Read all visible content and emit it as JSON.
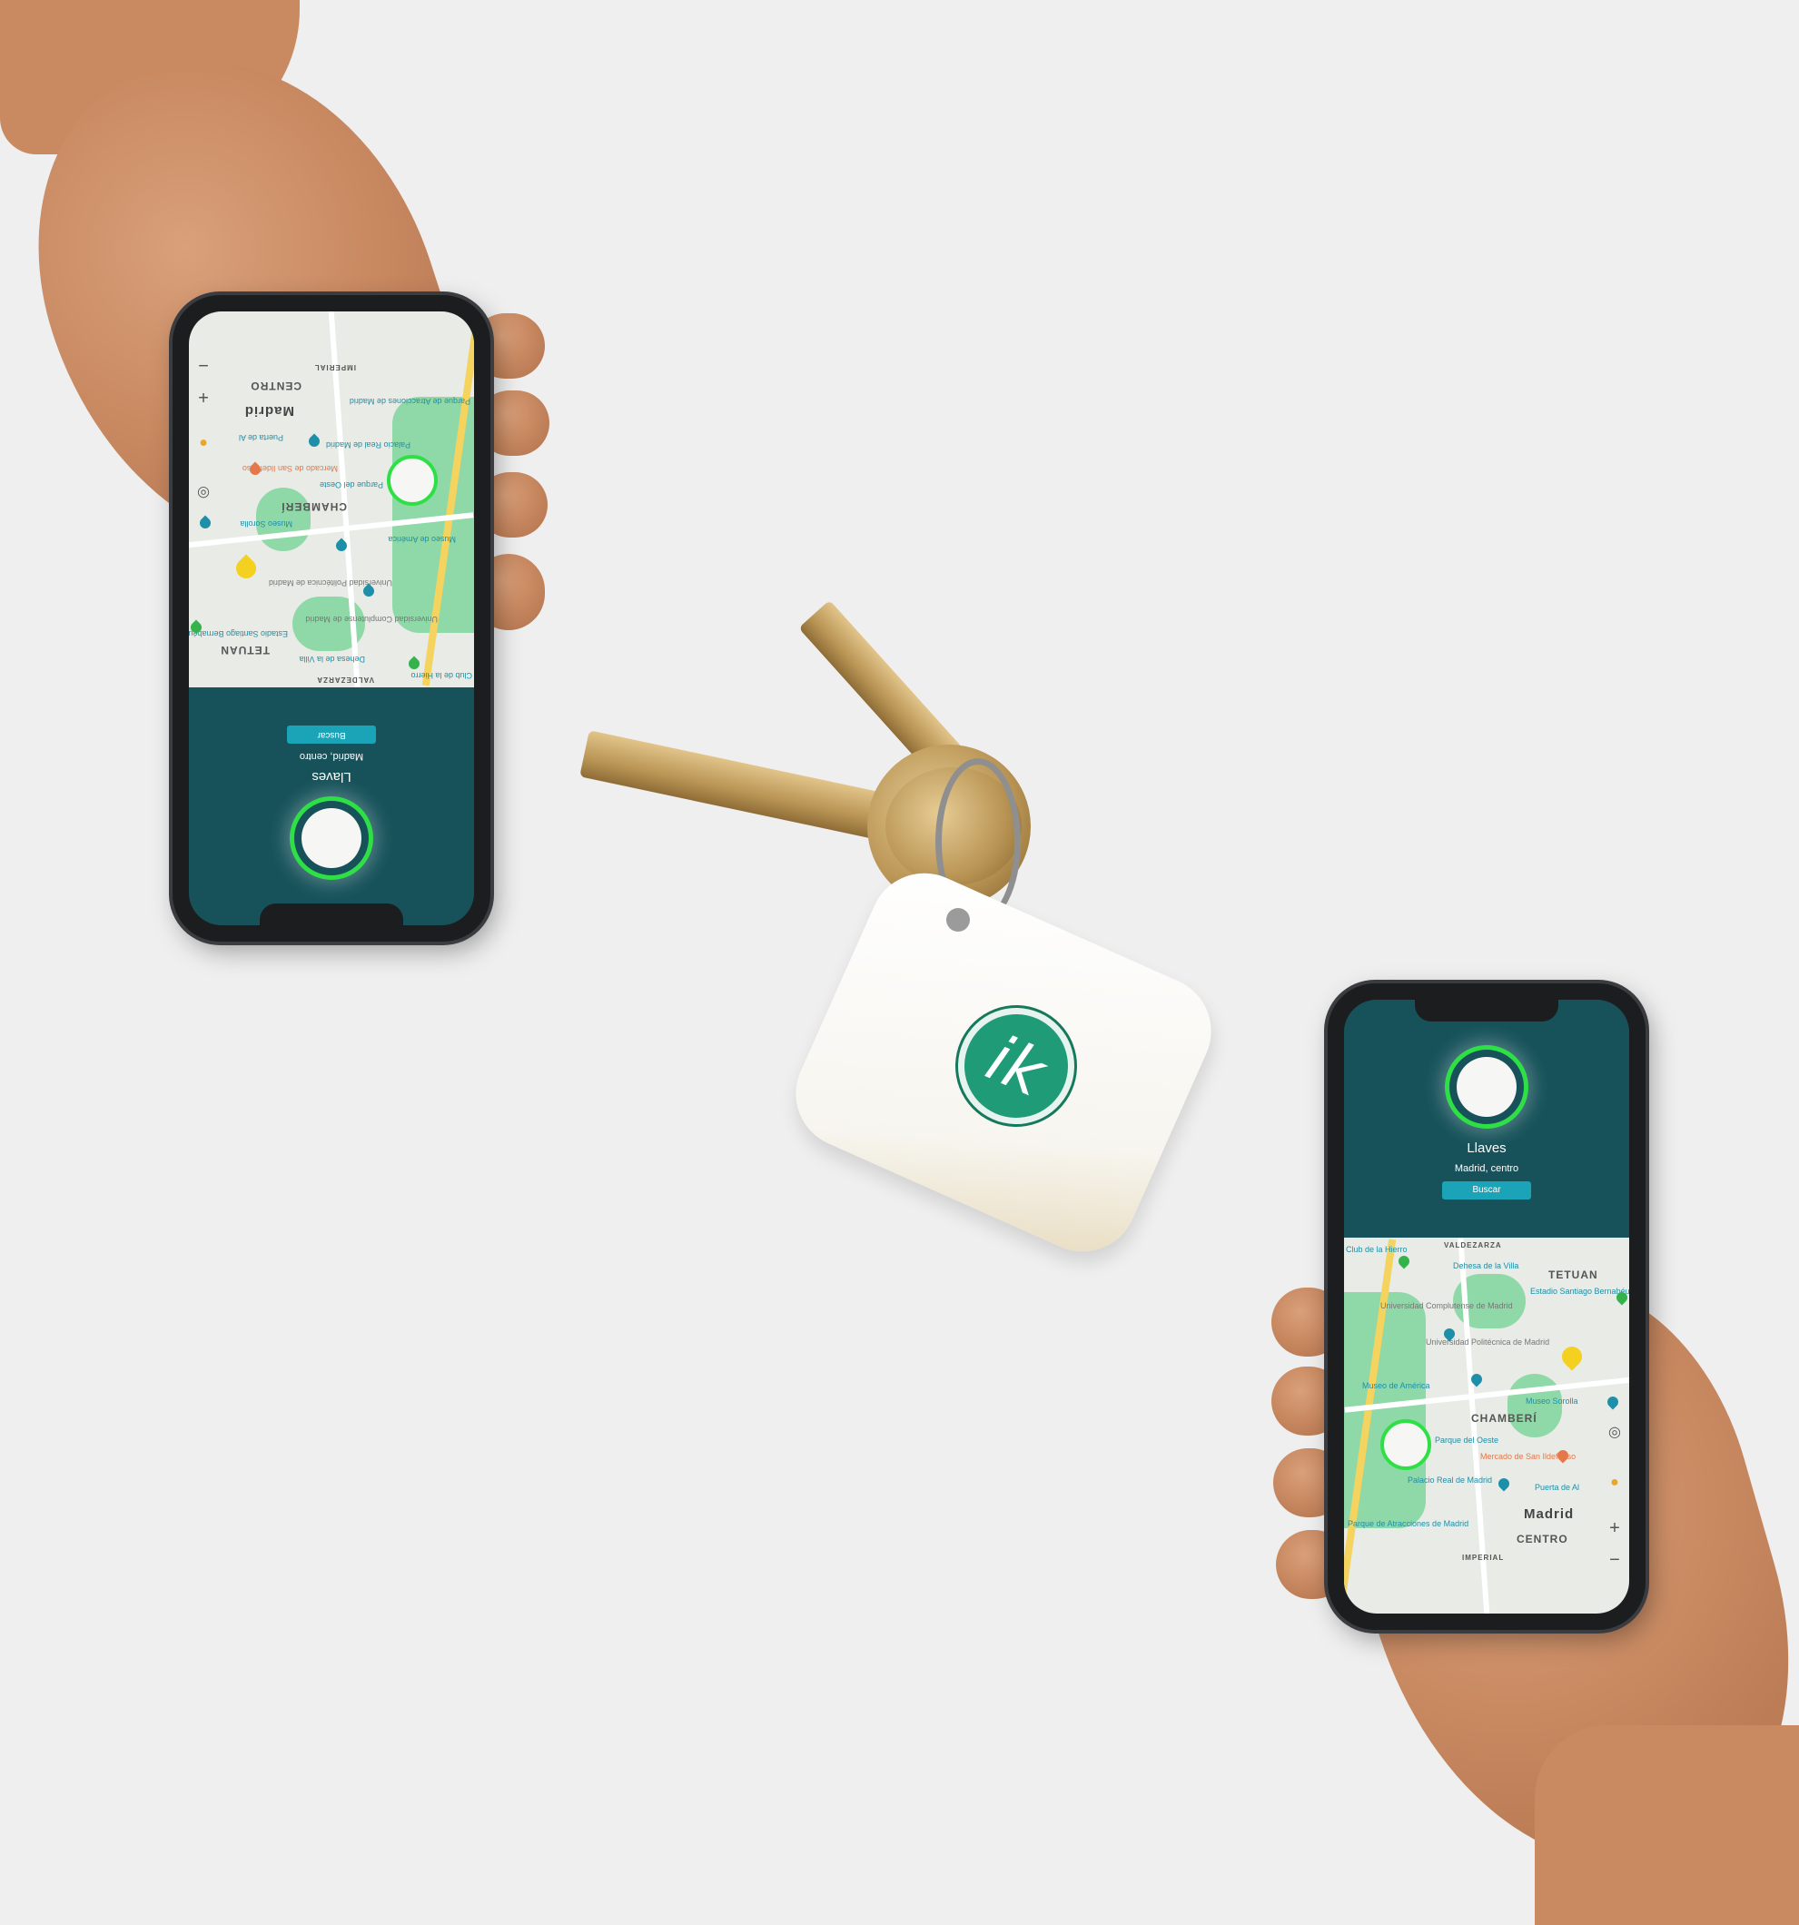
{
  "phones": [
    {
      "orientation": "upside-down",
      "tracker": {
        "name": "Llaves",
        "location": "Madrid, centro",
        "search_button": "Buscar"
      },
      "map": {
        "labels": {
          "centro": "CENTRO",
          "madrid": "Madrid",
          "chamberi": "CHAMBERÍ",
          "tetuan": "TETUAN",
          "imperial": "IMPERIAL",
          "valdezarza": "VALDEZARZA",
          "palacio": "Palacio Real de Madrid",
          "puerta": "Puerta de Al",
          "mercado": "Mercado de San Ildefonso",
          "museo_sorolla": "Museo Sorolla",
          "museo_america": "Museo de América",
          "parque_atracciones": "Parque de Atracciones de Madrid",
          "parque_oeste": "Parque del Oeste",
          "complutense": "Universidad Complutense de Madrid",
          "politecnica": "Universidad Politécnica de Madrid",
          "estadio": "Estadio Santiago Bernabéu",
          "dehesa": "Dehesa de la Villa",
          "club": "Club de la Hierro"
        },
        "zoom_in": "+",
        "zoom_out": "−"
      }
    },
    {
      "orientation": "upright",
      "tracker": {
        "name": "Llaves",
        "location": "Madrid, centro",
        "search_button": "Buscar"
      },
      "map": {
        "labels": {
          "centro": "CENTRO",
          "madrid": "Madrid",
          "chamberi": "CHAMBERÍ",
          "tetuan": "TETUAN",
          "imperial": "IMPERIAL",
          "valdezarza": "VALDEZARZA",
          "palacio": "Palacio Real de Madrid",
          "puerta": "Puerta de Al",
          "mercado": "Mercado de San Ildefonso",
          "museo_sorolla": "Museo Sorolla",
          "museo_america": "Museo de América",
          "parque_atracciones": "Parque de Atracciones de Madrid",
          "parque_oeste": "Parque del Oeste",
          "complutense": "Universidad Complutense de Madrid",
          "politecnica": "Universidad Politécnica de Madrid",
          "estadio": "Estadio Santiago Bernabéu",
          "dehesa": "Dehesa de la Villa",
          "club": "Club de la Hierro"
        },
        "zoom_in": "+",
        "zoom_out": "−"
      }
    }
  ],
  "tag_logo": "ik",
  "colors": {
    "background": "#efefef",
    "panel": "#17525a",
    "ring": "#2ee045",
    "button": "#1ba4b8",
    "logo": "#1f9c77",
    "park": "#8fd9a8"
  }
}
